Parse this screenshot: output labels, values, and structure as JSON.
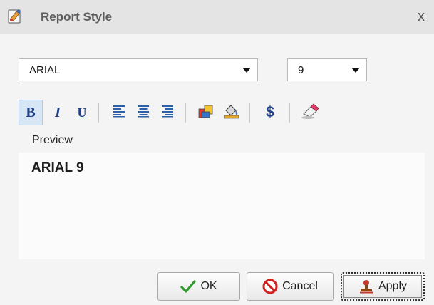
{
  "window": {
    "title": "Report Style",
    "close_label": "x"
  },
  "font": {
    "family": "ARIAL",
    "size": "9"
  },
  "toolbar": {
    "bold_label": "B",
    "italic_label": "I",
    "underline_label": "U",
    "currency_label": "$",
    "active": [
      "bold"
    ]
  },
  "preview": {
    "label": "Preview",
    "text": "ARIAL 9"
  },
  "buttons": {
    "ok": "OK",
    "cancel": "Cancel",
    "apply": "Apply"
  },
  "colors": {
    "title_bg": "#e4e4e4",
    "body_bg": "#f4f4f4",
    "accent": "#2a61a9",
    "ok_check": "#2e9b2e",
    "cancel_red": "#d02020"
  }
}
